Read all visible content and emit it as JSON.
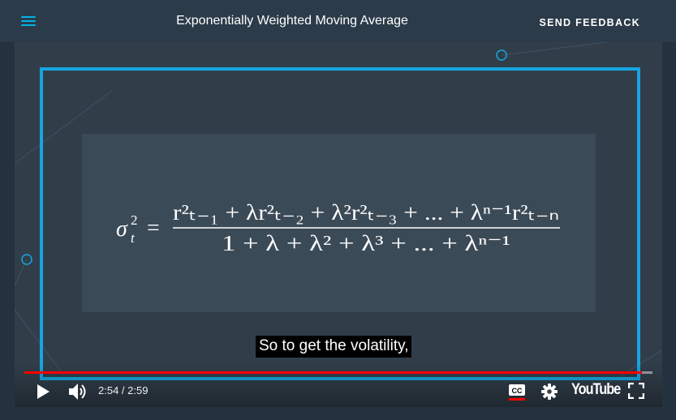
{
  "header": {
    "menu_icon": "hamburger-menu-icon",
    "title": "Exponentially Weighted Moving Average",
    "feedback_label": "SEND FEEDBACK",
    "accent_color": "#02b3e4"
  },
  "video": {
    "frame_color": "#16a6e0",
    "formula": {
      "lhs": "σ",
      "lhs_sup": "2",
      "lhs_sub": "t",
      "numerator": "r²ₜ₋₁ + λr²ₜ₋₂ + λ²r²ₜ₋₃ + ... + λⁿ⁻¹r²ₜ₋ₙ",
      "denominator": "1 + λ + λ² + λ³ + ... + λⁿ⁻¹"
    },
    "caption": "So to get the volatility,"
  },
  "controls": {
    "progress": 0.983,
    "progress_color": "#ff0000",
    "current_time": "2:54",
    "separator": " / ",
    "duration": "2:59",
    "play_icon": "play-icon",
    "volume_icon": "volume-icon",
    "cc_icon": "closed-captions-icon",
    "settings_icon": "gear-icon",
    "youtube_label": "YouTube",
    "fullscreen_icon": "fullscreen-icon"
  }
}
